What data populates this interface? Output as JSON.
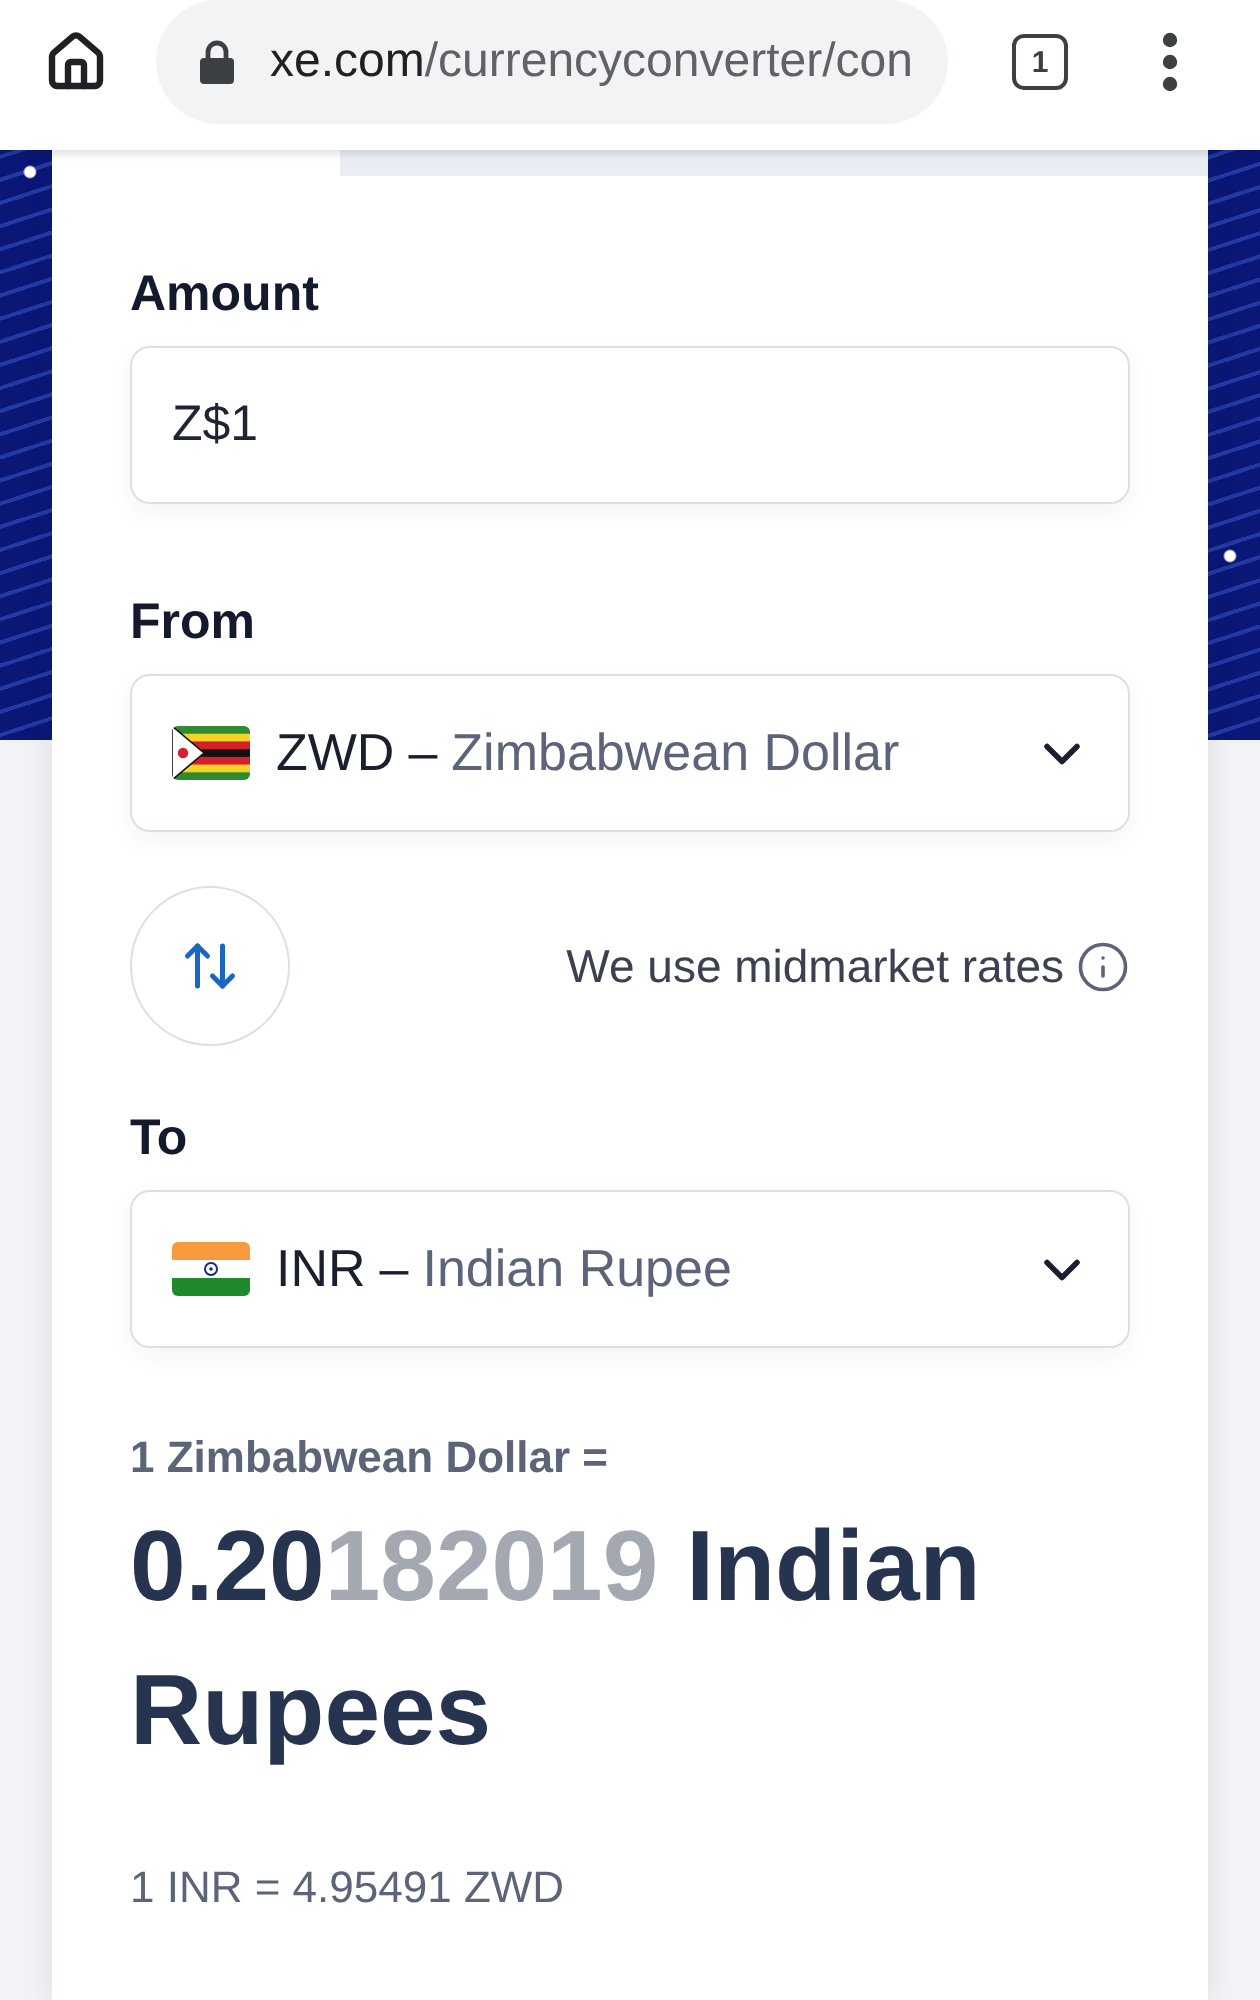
{
  "browser": {
    "url_domain": "xe.com",
    "url_path": "/currencyconverter/con",
    "tab_count": "1"
  },
  "converter": {
    "amount": {
      "label": "Amount",
      "value": "Z$1"
    },
    "from": {
      "label": "From",
      "code": "ZWD",
      "separator": "–",
      "name": "Zimbabwean Dollar"
    },
    "swap": {
      "note": "We use midmarket rates"
    },
    "to": {
      "label": "To",
      "code": "INR",
      "separator": "–",
      "name": "Indian Rupee"
    },
    "result": {
      "rate_label": "1 Zimbabwean Dollar =",
      "value_main": "0.20",
      "value_faded": "182019",
      "unit": "Indian Rupees",
      "inverse": "1 INR = 4.95491 ZWD"
    }
  }
}
